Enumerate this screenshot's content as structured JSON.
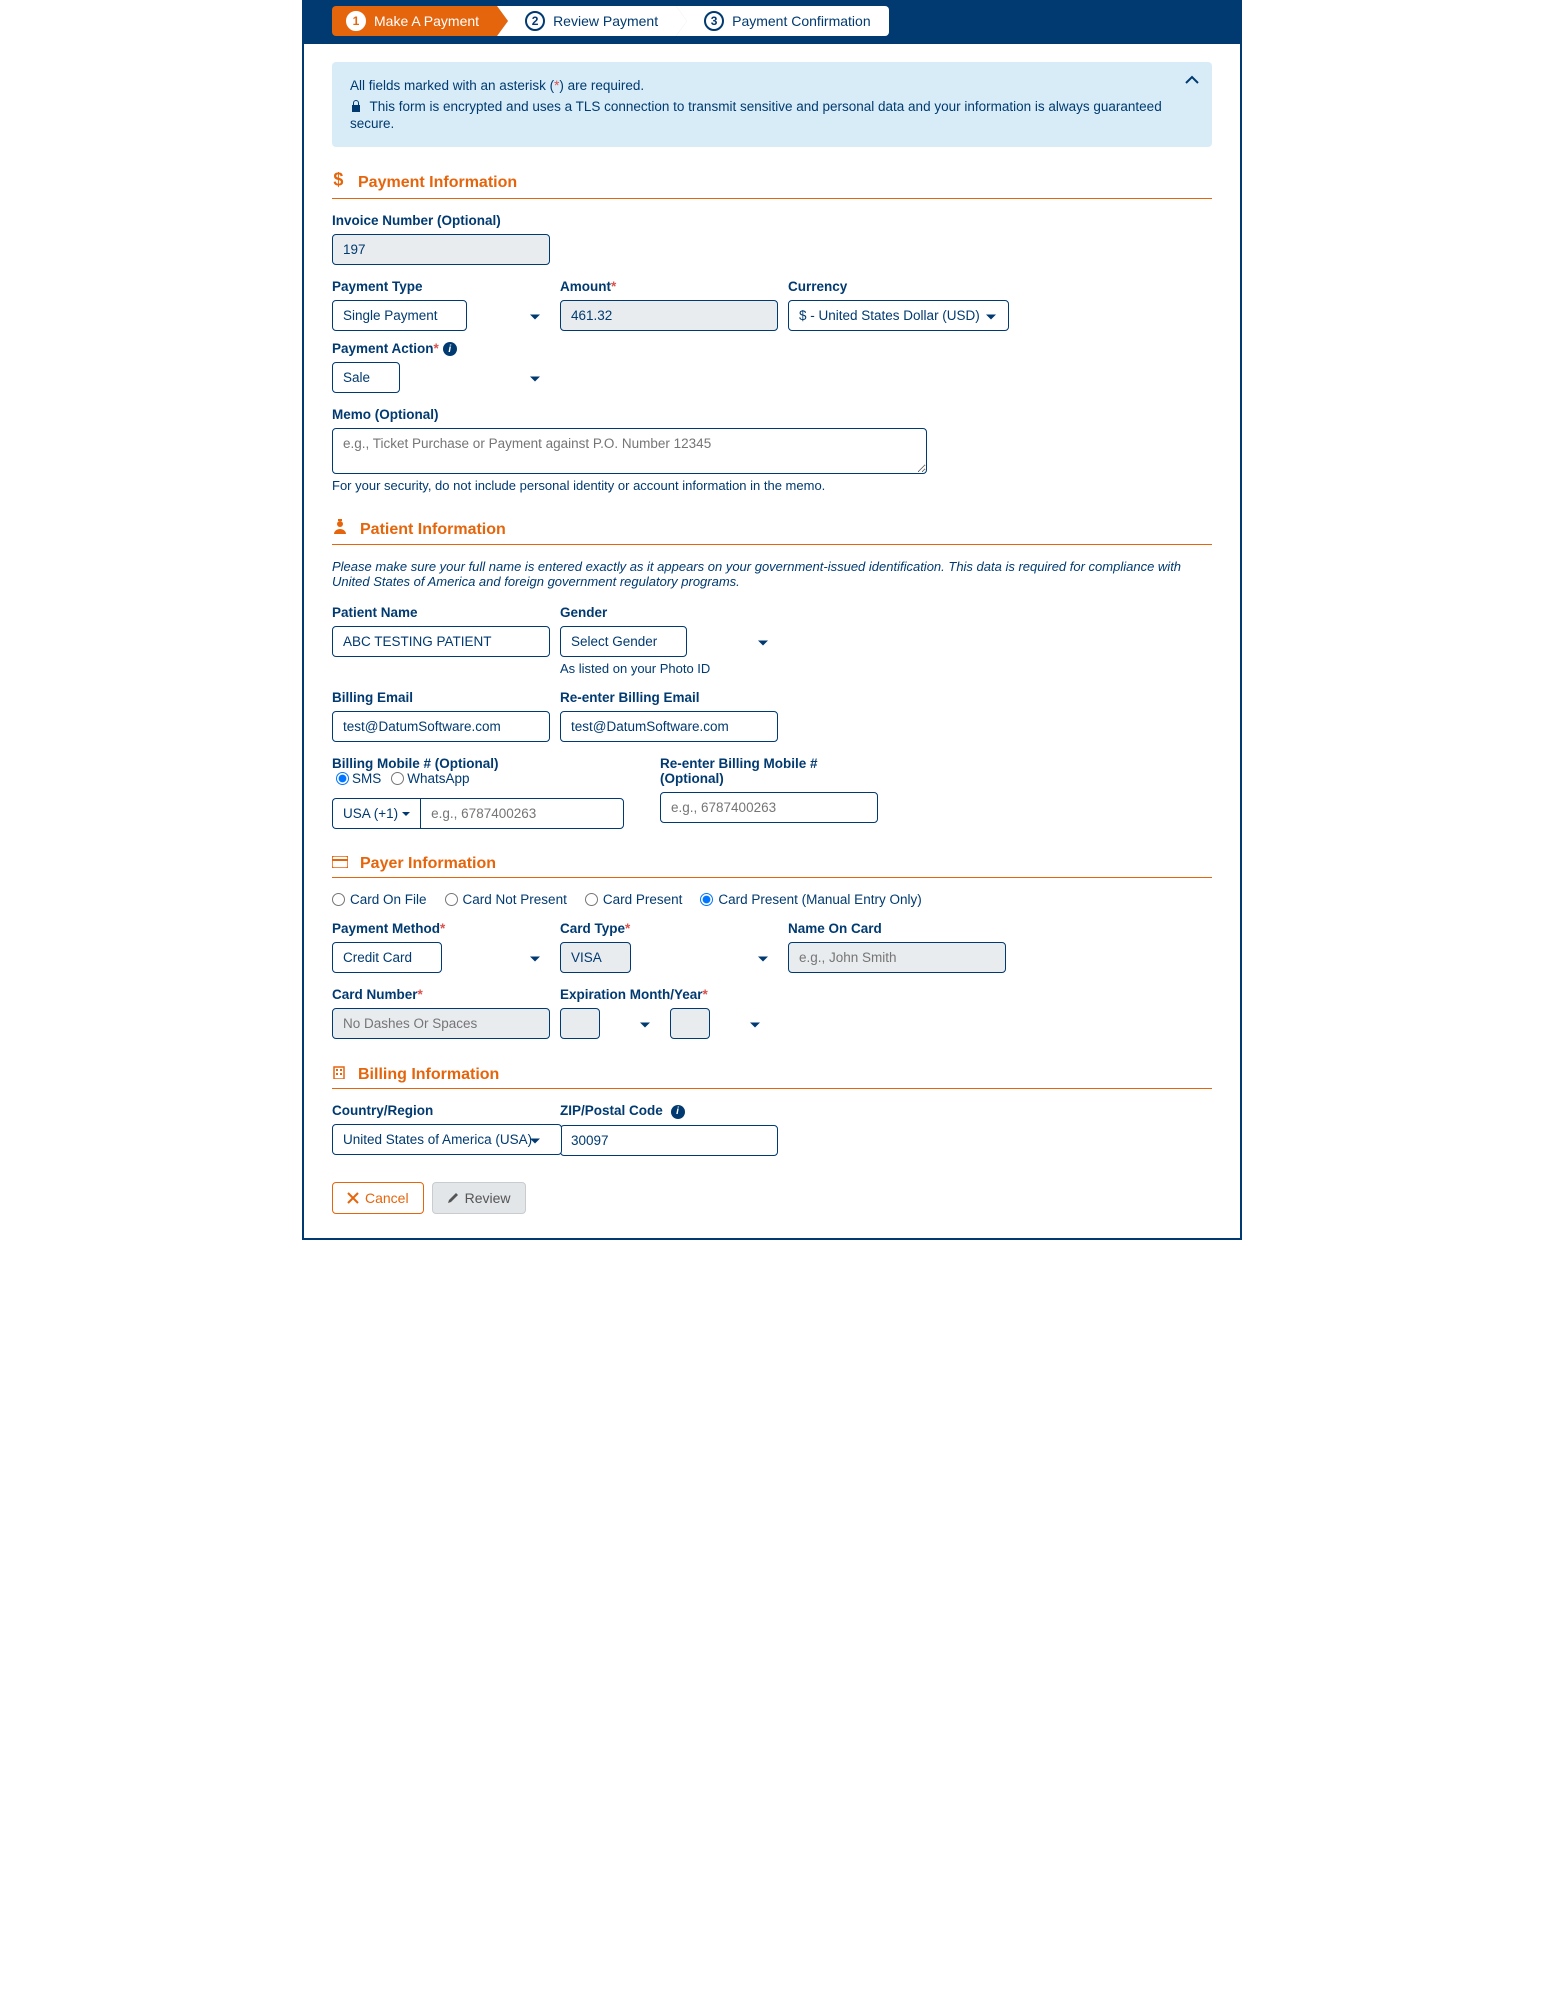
{
  "wizard": {
    "steps": [
      {
        "num": "1",
        "label": "Make A Payment"
      },
      {
        "num": "2",
        "label": "Review Payment"
      },
      {
        "num": "3",
        "label": "Payment Confirmation"
      }
    ]
  },
  "alert": {
    "required_prefix": "All fields marked with an asterisk (",
    "required_star": "*",
    "required_suffix": ") are required.",
    "secure": "This form is encrypted and uses a TLS connection to transmit sensitive and personal data and your information is always guaranteed secure."
  },
  "sections": {
    "payment_info": "Payment Information",
    "patient_info": "Patient Information",
    "payer_info": "Payer Information",
    "billing_info": "Billing Information"
  },
  "payment": {
    "invoice_label": "Invoice Number (Optional)",
    "invoice_value": "197",
    "type_label": "Payment Type",
    "type_value": "Single Payment",
    "amount_label": "Amount",
    "amount_value": "461.32",
    "currency_label": "Currency",
    "currency_value": "$ - United States Dollar (USD)",
    "action_label": "Payment Action",
    "action_value": "Sale",
    "memo_label": "Memo (Optional)",
    "memo_placeholder": "e.g., Ticket Purchase or Payment against P.O. Number 12345",
    "memo_helper": "For your security, do not include personal identity or account information in the memo."
  },
  "patient": {
    "intro": "Please make sure your full name is entered exactly as it appears on your government-issued identification. This data is required for compliance with United States of America and foreign government regulatory programs.",
    "name_label": "Patient Name",
    "name_value": "ABC TESTING PATIENT",
    "gender_label": "Gender",
    "gender_value": "Select Gender",
    "gender_helper": "As listed on your Photo ID",
    "email_label": "Billing Email",
    "email_value": "test@DatumSoftware.com",
    "reemail_label": "Re-enter Billing Email",
    "reemail_value": "test@DatumSoftware.com",
    "mobile_label": "Billing Mobile # (Optional)",
    "sms_label": "SMS",
    "whatsapp_label": "WhatsApp",
    "cc_value": "USA (+1)",
    "mobile_placeholder": "e.g., 6787400263",
    "remobile_label": "Re-enter Billing Mobile # (Optional)",
    "remobile_placeholder": "e.g., 6787400263"
  },
  "payer": {
    "radios": {
      "on_file": "Card On File",
      "not_present": "Card Not Present",
      "present": "Card Present",
      "present_manual": "Card Present (Manual Entry Only)"
    },
    "method_label": "Payment Method",
    "method_value": "Credit Card",
    "card_type_label": "Card Type",
    "card_type_value": "VISA",
    "name_on_card_label": "Name On Card",
    "name_on_card_placeholder": "e.g., John Smith",
    "card_num_label": "Card Number",
    "card_num_placeholder": "No Dashes Or Spaces",
    "exp_label": "Expiration Month/Year"
  },
  "billing": {
    "country_label": "Country/Region",
    "country_value": "United States of America (USA)",
    "zip_label": "ZIP/Postal Code",
    "zip_value": "30097"
  },
  "buttons": {
    "cancel": "Cancel",
    "review": "Review"
  }
}
